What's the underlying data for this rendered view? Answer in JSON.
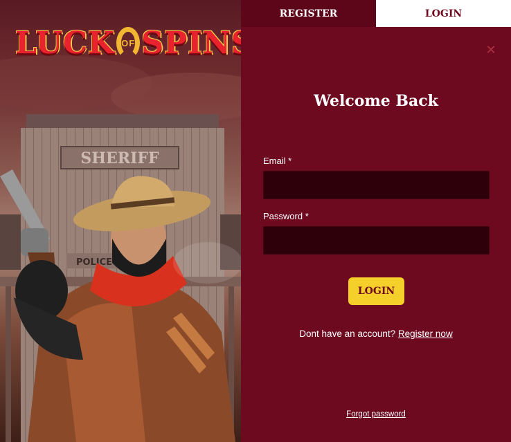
{
  "logo": {
    "part1": "LUCK",
    "part2": "OF",
    "part3": "SPINS"
  },
  "hero": {
    "sign_text": "SHERIFF",
    "sign2_text": "POLICE"
  },
  "tabs": [
    {
      "label": "REGISTER",
      "active": false
    },
    {
      "label": "LOGIN",
      "active": true
    }
  ],
  "close_icon": "close-icon",
  "form": {
    "title": "Welcome Back",
    "email_label": "Email *",
    "email_value": "",
    "password_label": "Password *",
    "password_value": "",
    "submit_label": "LOGIN",
    "signup_prompt": "Dont have an account?",
    "signup_link": "Register now",
    "forgot_link": "Forgot password"
  },
  "colors": {
    "panel_bg": "#6d0a20",
    "tab_inactive_bg": "#5e0619",
    "tab_active_bg": "#ffffff",
    "input_bg": "#2e0009",
    "button_bg": "#f6d02a",
    "logo_red": "#e8232e",
    "logo_gold": "#f2b632"
  }
}
